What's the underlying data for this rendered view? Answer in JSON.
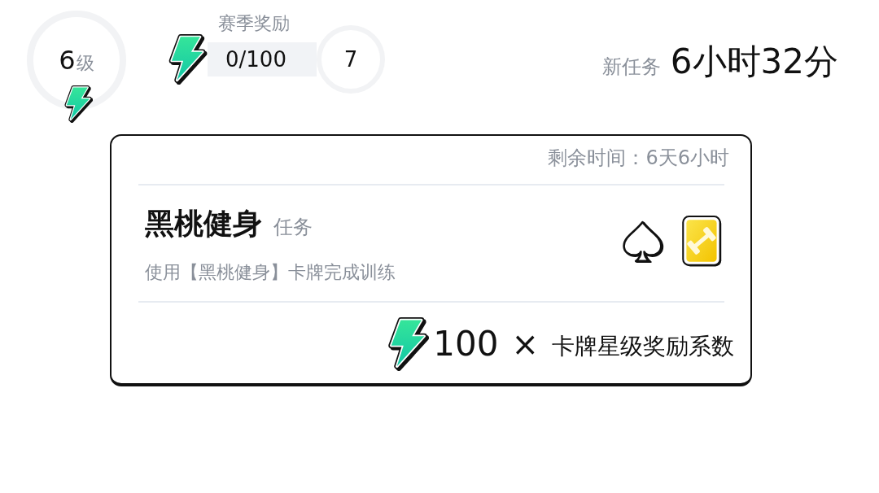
{
  "level_badge": {
    "value": "6",
    "unit": "级"
  },
  "season_reward": {
    "title": "赛季奖励",
    "progress": "0/100",
    "next_level": "7"
  },
  "new_task": {
    "label": "新任务",
    "countdown": "6小时32分"
  },
  "task_card": {
    "remaining_time": "剩余时间：6天6小时",
    "title": "黑桃健身",
    "tag": "任务",
    "description": "使用【黑桃健身】卡牌完成训练",
    "reward": {
      "amount": "100",
      "operator": "×",
      "multiplier_label": "卡牌星级奖励系数"
    }
  }
}
